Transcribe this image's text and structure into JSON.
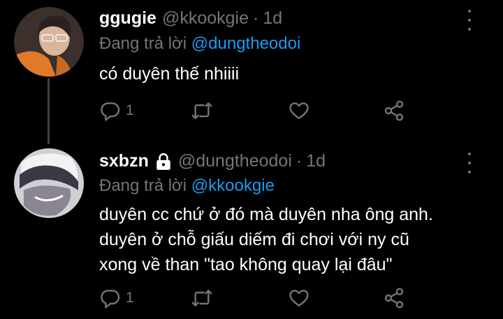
{
  "tweets": [
    {
      "display_name": "ggugie",
      "handle": "@kkookgie",
      "separator": "·",
      "time": "1d",
      "reply_prefix": "Đang trả lời ",
      "reply_mention": "@dungtheodoi",
      "text_lines": [
        "có duyên thế nhiiii"
      ],
      "reply_count": "1",
      "locked": false
    },
    {
      "display_name": "sxbzn",
      "handle": "@dungtheodoi",
      "separator": "·",
      "time": "1d",
      "reply_prefix": "Đang trả lời ",
      "reply_mention": "@kkookgie",
      "text_lines": [
        "duyên cc chứ ở đó mà duyên nha ông anh.",
        "duyên ở chỗ giấu diếm đi chơi với ny cũ",
        "xong về than \"tao không quay lại đâu\""
      ],
      "reply_count": "1",
      "locked": true
    }
  ],
  "colors": {
    "background": "#000000",
    "text": "#ffffff",
    "muted": "#71767b",
    "link": "#1d9bf0"
  },
  "icons": [
    "lock-icon",
    "more-icon",
    "reply-icon",
    "retweet-icon",
    "like-icon",
    "share-icon"
  ]
}
